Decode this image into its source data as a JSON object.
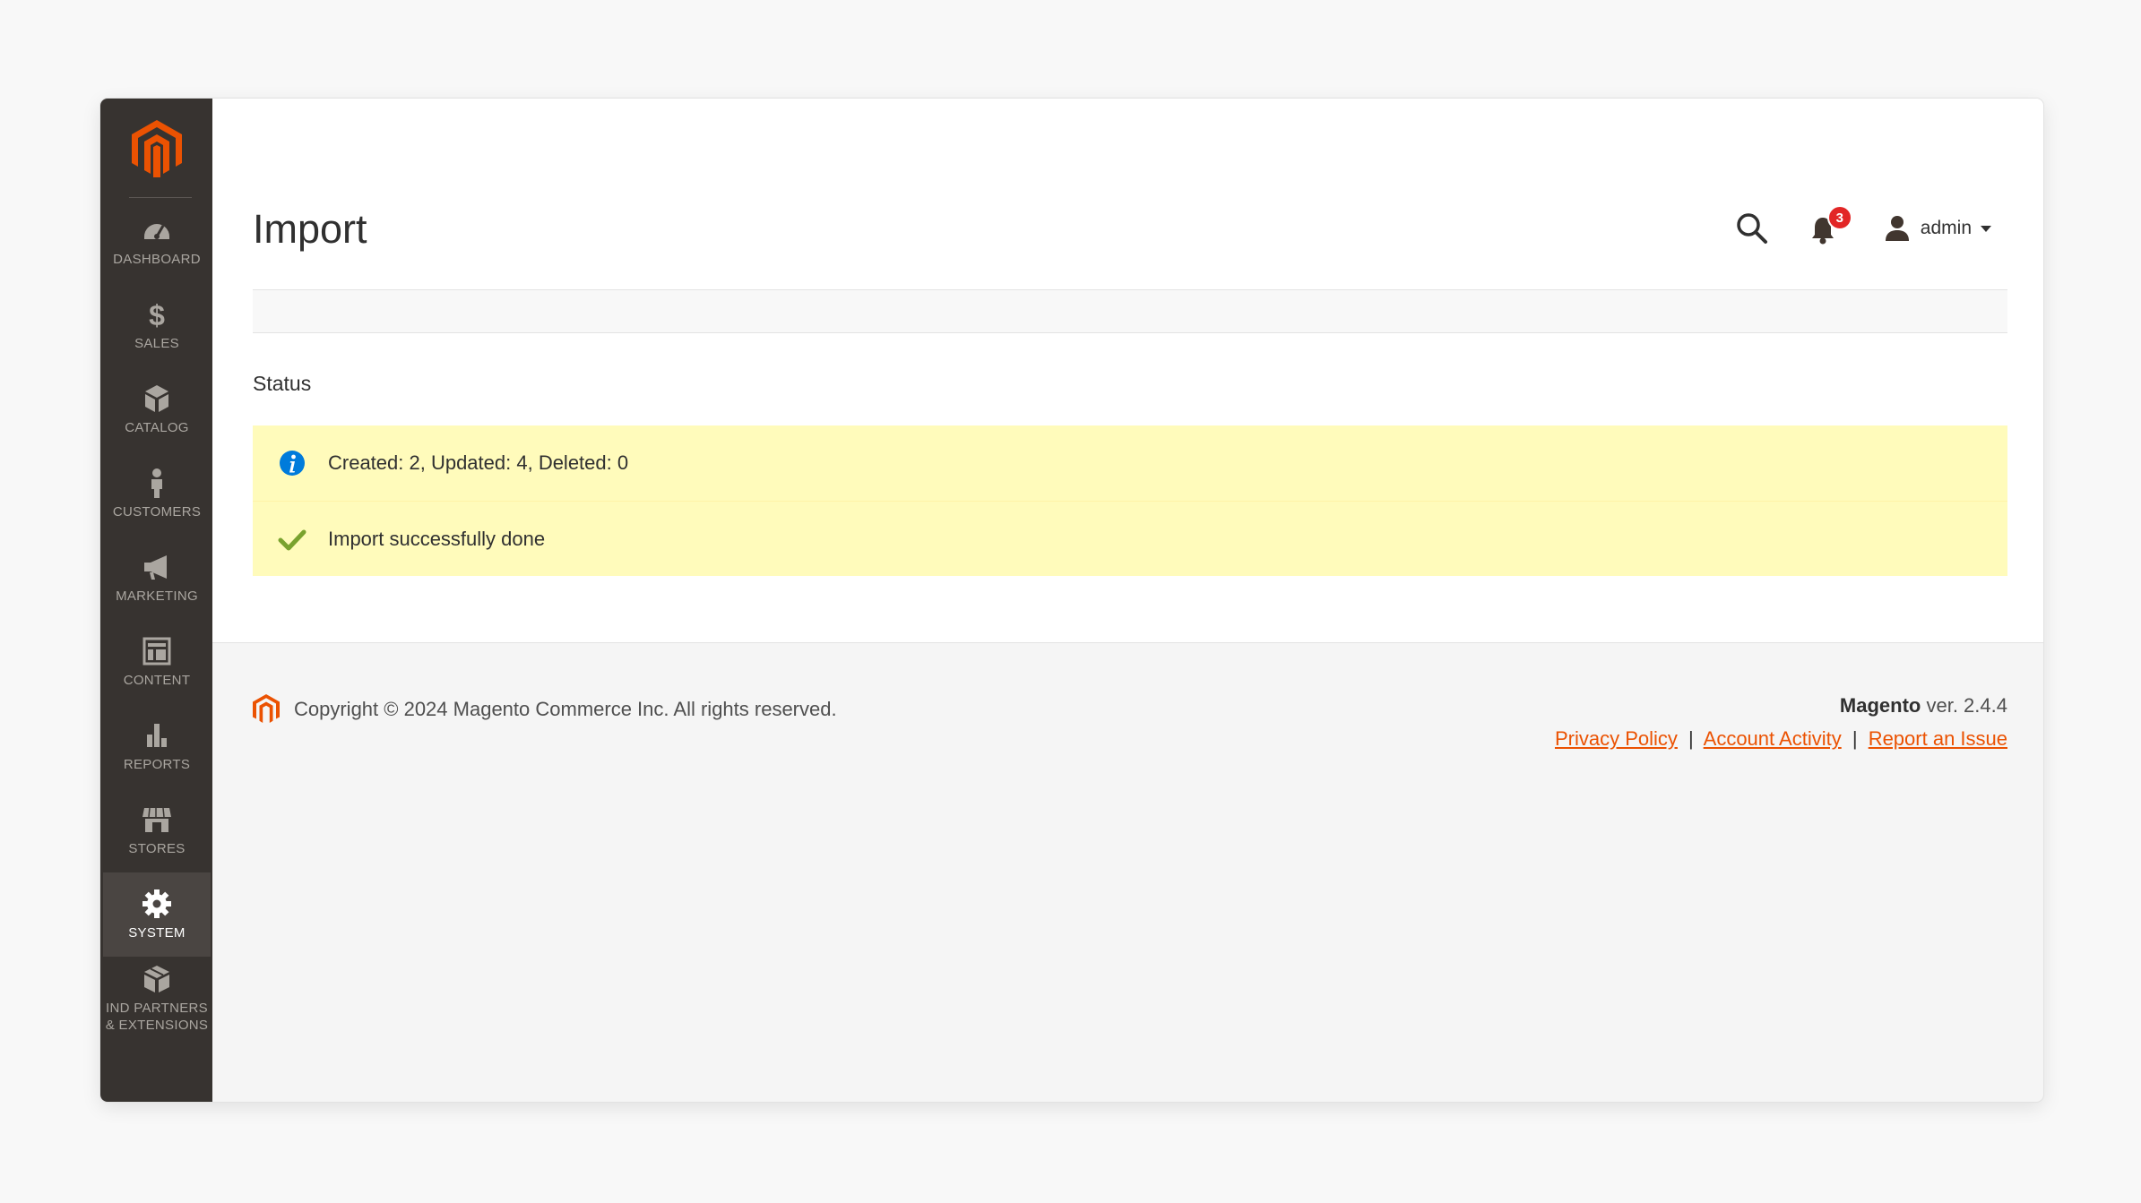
{
  "page": {
    "title": "Import"
  },
  "sidebar": {
    "items": [
      {
        "label": "DASHBOARD",
        "icon": "dashboard-icon"
      },
      {
        "label": "SALES",
        "icon": "dollar-icon"
      },
      {
        "label": "CATALOG",
        "icon": "cube-icon"
      },
      {
        "label": "CUSTOMERS",
        "icon": "person-icon"
      },
      {
        "label": "MARKETING",
        "icon": "megaphone-icon"
      },
      {
        "label": "CONTENT",
        "icon": "layout-icon"
      },
      {
        "label": "REPORTS",
        "icon": "bar-chart-icon"
      },
      {
        "label": "STORES",
        "icon": "storefront-icon"
      },
      {
        "label": "SYSTEM",
        "icon": "gear-icon",
        "active": true
      },
      {
        "label": "IND PARTNERS\n& EXTENSIONS",
        "icon": "box-icon"
      }
    ]
  },
  "header": {
    "notifications_count": "3",
    "user_name": "admin"
  },
  "status": {
    "heading": "Status",
    "messages": [
      {
        "type": "info",
        "text": "Created: 2, Updated: 4, Deleted: 0"
      },
      {
        "type": "success",
        "text": "Import successfully done"
      }
    ]
  },
  "footer": {
    "copyright": "Copyright © 2024 Magento Commerce Inc. All rights reserved.",
    "brand": "Magento",
    "version": " ver. 2.4.4",
    "links": [
      "Privacy Policy",
      "Account Activity",
      "Report an Issue"
    ],
    "separator": "|"
  },
  "colors": {
    "accent": "#eb5202",
    "sidebar": "#373330",
    "message_bg": "#fffbbb",
    "badge": "#e22626"
  }
}
